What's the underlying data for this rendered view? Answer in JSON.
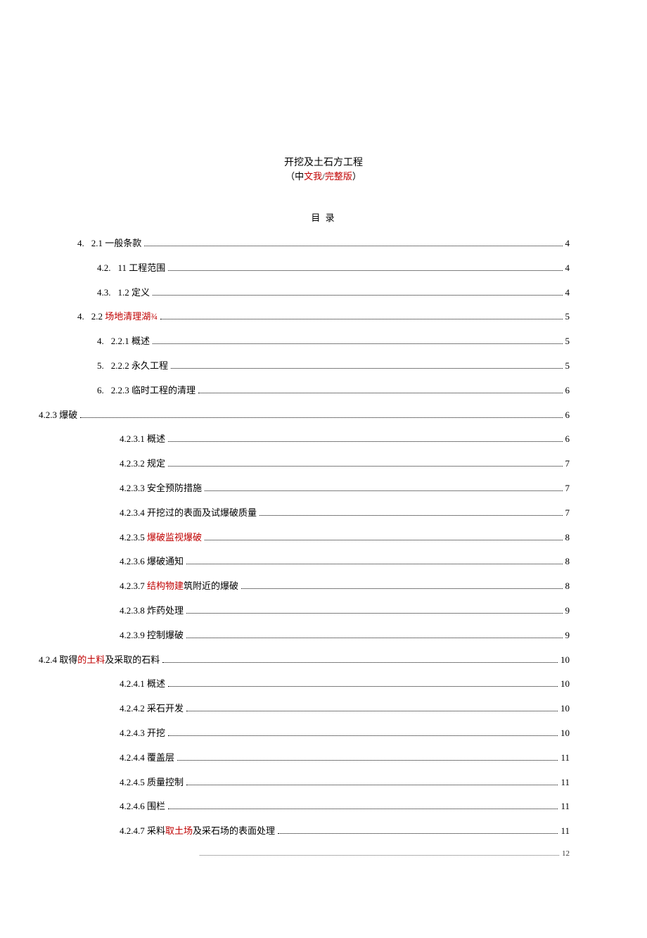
{
  "title": {
    "line1": "开挖及土石方工程",
    "line2_open": "（中",
    "line2_red1": "文我",
    "line2_mid": "/",
    "line2_red2": "完整版",
    "line2_close": "）"
  },
  "toc_header": "目 录",
  "entries": [
    {
      "indent": 0,
      "num": "4.",
      "parts": [
        {
          "t": "2.1 一般条款"
        }
      ],
      "page": "4"
    },
    {
      "indent": 1,
      "num": "4.2.",
      "parts": [
        {
          "t": "11 工程范围"
        }
      ],
      "page": "4"
    },
    {
      "indent": 1,
      "num": "4.3.",
      "parts": [
        {
          "t": "1.2 定义"
        }
      ],
      "page": "4"
    },
    {
      "indent": 0,
      "num": "4.",
      "parts": [
        {
          "t": "2.2 "
        },
        {
          "t": "场地清理湖¾",
          "red": true
        }
      ],
      "page": "5"
    },
    {
      "indent": 1,
      "num": "4.",
      "parts": [
        {
          "t": "2.2.1 概述"
        }
      ],
      "page": "5"
    },
    {
      "indent": 1,
      "num": "5.",
      "parts": [
        {
          "t": "2.2.2 永久工程"
        }
      ],
      "page": "5"
    },
    {
      "indent": 1,
      "num": "6.",
      "parts": [
        {
          "t": "2.2.3 临时工程的清理"
        }
      ],
      "page": "6"
    },
    {
      "indent": 0,
      "num": "",
      "parts": [
        {
          "t": "4.2.3 爆破"
        }
      ],
      "page": "6",
      "outdent": true
    },
    {
      "indent": 2,
      "num": "",
      "parts": [
        {
          "t": "4.2.3.1 概述"
        }
      ],
      "page": "6"
    },
    {
      "indent": 2,
      "num": "",
      "parts": [
        {
          "t": "4.2.3.2 规定"
        }
      ],
      "page": "7"
    },
    {
      "indent": 2,
      "num": "",
      "parts": [
        {
          "t": "4.2.3.3 安全预防措施"
        }
      ],
      "page": "7"
    },
    {
      "indent": 2,
      "num": "",
      "parts": [
        {
          "t": "4.2.3.4 开挖过的表面及试爆破质量"
        }
      ],
      "page": "7"
    },
    {
      "indent": 2,
      "num": "",
      "parts": [
        {
          "t": "4.2.3.5 "
        },
        {
          "t": "爆破监视爆破",
          "red": true
        }
      ],
      "page": "8"
    },
    {
      "indent": 2,
      "num": "",
      "parts": [
        {
          "t": "4.2.3.6 爆破通知"
        }
      ],
      "page": "8"
    },
    {
      "indent": 2,
      "num": "",
      "parts": [
        {
          "t": "4.2.3.7 "
        },
        {
          "t": "结构物建",
          "red": true
        },
        {
          "t": "筑附近的爆破"
        }
      ],
      "page": "8"
    },
    {
      "indent": 2,
      "num": "",
      "parts": [
        {
          "t": "4.2.3.8 炸药处理"
        }
      ],
      "page": "9"
    },
    {
      "indent": 2,
      "num": "",
      "parts": [
        {
          "t": "4.2.3.9 控制爆破"
        }
      ],
      "page": "9"
    },
    {
      "indent": 0,
      "num": "",
      "parts": [
        {
          "t": "4.2.4 取得"
        },
        {
          "t": "的土料",
          "red": true
        },
        {
          "t": "及采取的石料"
        }
      ],
      "page": "10",
      "outdent": true
    },
    {
      "indent": 2,
      "num": "",
      "parts": [
        {
          "t": "4.2.4.1 概述"
        }
      ],
      "page": "10"
    },
    {
      "indent": 2,
      "num": "",
      "parts": [
        {
          "t": "4.2.4.2 采石开发"
        }
      ],
      "page": "10"
    },
    {
      "indent": 2,
      "num": "",
      "parts": [
        {
          "t": "4.2.4.3 开挖"
        }
      ],
      "page": "10"
    },
    {
      "indent": 2,
      "num": "",
      "parts": [
        {
          "t": "4.2.4.4 覆盖层"
        }
      ],
      "page": "11"
    },
    {
      "indent": 2,
      "num": "",
      "parts": [
        {
          "t": "4.2.4.5 质量控制"
        }
      ],
      "page": "11"
    },
    {
      "indent": 2,
      "num": "",
      "parts": [
        {
          "t": "4.2.4.6 围栏"
        }
      ],
      "page": "11"
    },
    {
      "indent": 2,
      "num": "",
      "parts": [
        {
          "t": "4.2.4.7 采料"
        },
        {
          "t": "取土场",
          "red": true
        },
        {
          "t": "及采石场的表面处理"
        }
      ],
      "page": "11"
    }
  ],
  "last_page": "12"
}
